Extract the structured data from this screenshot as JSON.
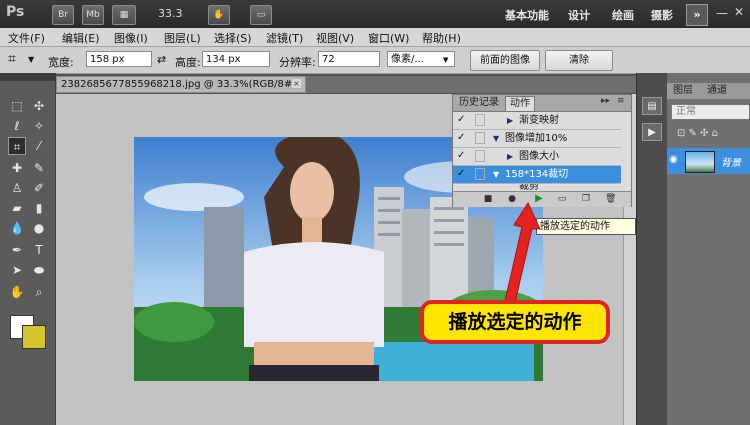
{
  "app_bar": {
    "logo": "Ps",
    "chips": [
      "Br",
      "Mb"
    ],
    "zoom_value": "33.3",
    "workspaces": [
      "基本功能",
      "设计",
      "绘画",
      "摄影"
    ],
    "more": "»"
  },
  "menu": [
    "文件(F)",
    "编辑(E)",
    "图像(I)",
    "图层(L)",
    "选择(S)",
    "滤镜(T)",
    "视图(V)",
    "窗口(W)",
    "帮助(H)"
  ],
  "options": {
    "width_label": "宽度:",
    "width_value": "158 px",
    "swap": "⇄",
    "height_label": "高度:",
    "height_value": "134 px",
    "resolution_label": "分辨率:",
    "resolution_value": "72",
    "unit_value": "像素/...",
    "front_image_button": "前面的图像",
    "clear_button": "清除"
  },
  "document": {
    "tab_title": "2382685677855968218.jpg @ 33.3%(RGB/8#)",
    "close": "×"
  },
  "actions_panel": {
    "tabs": [
      "历史记录",
      "动作"
    ],
    "active_tab": "动作",
    "rows": [
      {
        "label": "渐变映射",
        "indent": 2,
        "check": "✓",
        "selected": false
      },
      {
        "label": "图像增加10%",
        "indent": 1,
        "check": "✓",
        "selected": false
      },
      {
        "label": "图像大小",
        "indent": 2,
        "check": "✓",
        "selected": false
      },
      {
        "label": "158*134裁切",
        "indent": 1,
        "check": "✓",
        "selected": true
      },
      {
        "label": "裁剪",
        "indent": 2,
        "check": "✓",
        "selected": false
      }
    ]
  },
  "tooltip": "播放选定的动作",
  "callout": "播放选定的动作",
  "layers_panel": {
    "tabs": [
      "图层",
      "通道"
    ],
    "blend_mode": "正常",
    "layer_name": "背景"
  },
  "colors": {
    "foreground": "#ffffff",
    "background": "#d4c52b",
    "callout_fill": "#ffe600",
    "callout_border": "#e32222",
    "selection": "#3b8fde"
  }
}
